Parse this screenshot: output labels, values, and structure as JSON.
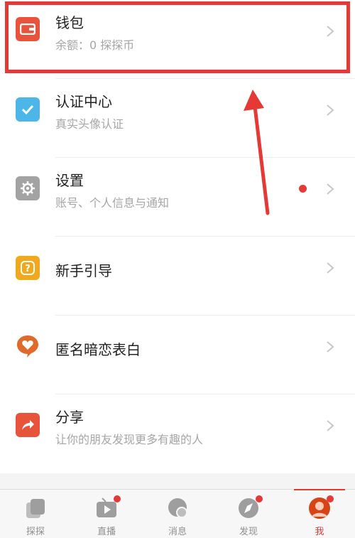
{
  "menu": {
    "items": [
      {
        "title": "钱包",
        "subtitle": "余额：0 探探币",
        "icon": "wallet-icon",
        "color": "#e8533b"
      },
      {
        "title": "认证中心",
        "subtitle": "真实头像认证",
        "icon": "checkmark-icon",
        "color": "#4db6e8"
      },
      {
        "title": "设置",
        "subtitle": "账号、个人信息与通知",
        "icon": "gear-icon",
        "color": "#a3a3a3",
        "has_dot": true
      },
      {
        "title": "新手引导",
        "subtitle": "",
        "icon": "question-icon",
        "color": "#f2a81d"
      },
      {
        "title": "匿名暗恋表白",
        "subtitle": "",
        "icon": "heart-bubble-icon",
        "color": "#e06a2a"
      },
      {
        "title": "分享",
        "subtitle": "让你的朋友发现更多有趣的人",
        "icon": "share-icon",
        "color": "#e8533b"
      }
    ]
  },
  "tabbar": {
    "tabs": [
      {
        "label": "探探",
        "icon": "cards-icon",
        "active": false,
        "badge": false
      },
      {
        "label": "直播",
        "icon": "tv-play-icon",
        "active": false,
        "badge": true
      },
      {
        "label": "消息",
        "icon": "chat-bubble-icon",
        "active": false,
        "badge": false
      },
      {
        "label": "发现",
        "icon": "compass-icon",
        "active": false,
        "badge": true
      },
      {
        "label": "我",
        "icon": "avatar-icon",
        "active": true,
        "badge": true
      }
    ]
  },
  "colors": {
    "accent": "#e53935",
    "highlight": "#e53935"
  }
}
